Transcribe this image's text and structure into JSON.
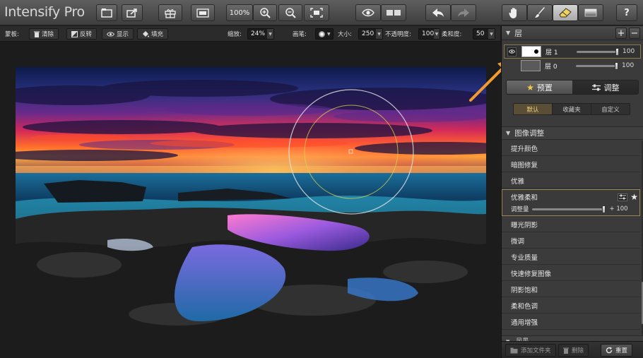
{
  "app": {
    "title": "Intensify Pro"
  },
  "toolbar": {
    "zoom_label": "100%",
    "buttons": [
      "open-file",
      "share",
      "gift",
      "compare-split",
      "zoom-100",
      "zoom-in",
      "zoom-out",
      "fit-screen",
      "preview-eye",
      "compare-before-after",
      "undo",
      "redo",
      "hand-tool",
      "brush-tool",
      "eraser-tool",
      "gradient-tool",
      "help"
    ],
    "help_label": "?"
  },
  "options": {
    "mask_label": "蒙板:",
    "clear_label": "清除",
    "invert_label": "反转",
    "show_label": "显示",
    "fill_label": "填充",
    "zoom_label": "缩放:",
    "zoom_value": "24%",
    "brush_label": "画笔:",
    "size_label": "大小:",
    "size_value": "250",
    "opacity_label": "不透明度:",
    "opacity_value": "100",
    "softness_label": "柔和度:",
    "softness_value": "50"
  },
  "layers": {
    "header": "层",
    "add_label": "+",
    "remove_label": "−",
    "items": [
      {
        "name": "层 1",
        "value": "100",
        "level": 100,
        "selected": true
      },
      {
        "name": "层 0",
        "value": "100",
        "level": 100,
        "selected": false
      }
    ]
  },
  "tabs": {
    "presets": "预置",
    "adjust": "调整"
  },
  "subtabs": {
    "default": "默认",
    "favorites": "收藏夹",
    "custom": "自定义"
  },
  "presets": {
    "header": "图像调整",
    "items": [
      "提升颜色",
      "暗图修复",
      "优雅",
      "优雅柔和",
      "曝光阴影",
      "微调",
      "专业质量",
      "快速修复图像",
      "阴影饱和",
      "柔和色调",
      "通用增强"
    ],
    "selected_index": 3,
    "selected_amount_label": "调整量",
    "selected_amount_value": "+ 100",
    "selected_amount_level": 100
  },
  "next_section": "风景",
  "bottom": {
    "add_folder": "添加文件夹",
    "delete": "删除",
    "reset": "重置"
  },
  "colors": {
    "accent_border": "#8d7a49",
    "active_subtab": "#f0d27a",
    "arrow": "#f29a2e"
  }
}
